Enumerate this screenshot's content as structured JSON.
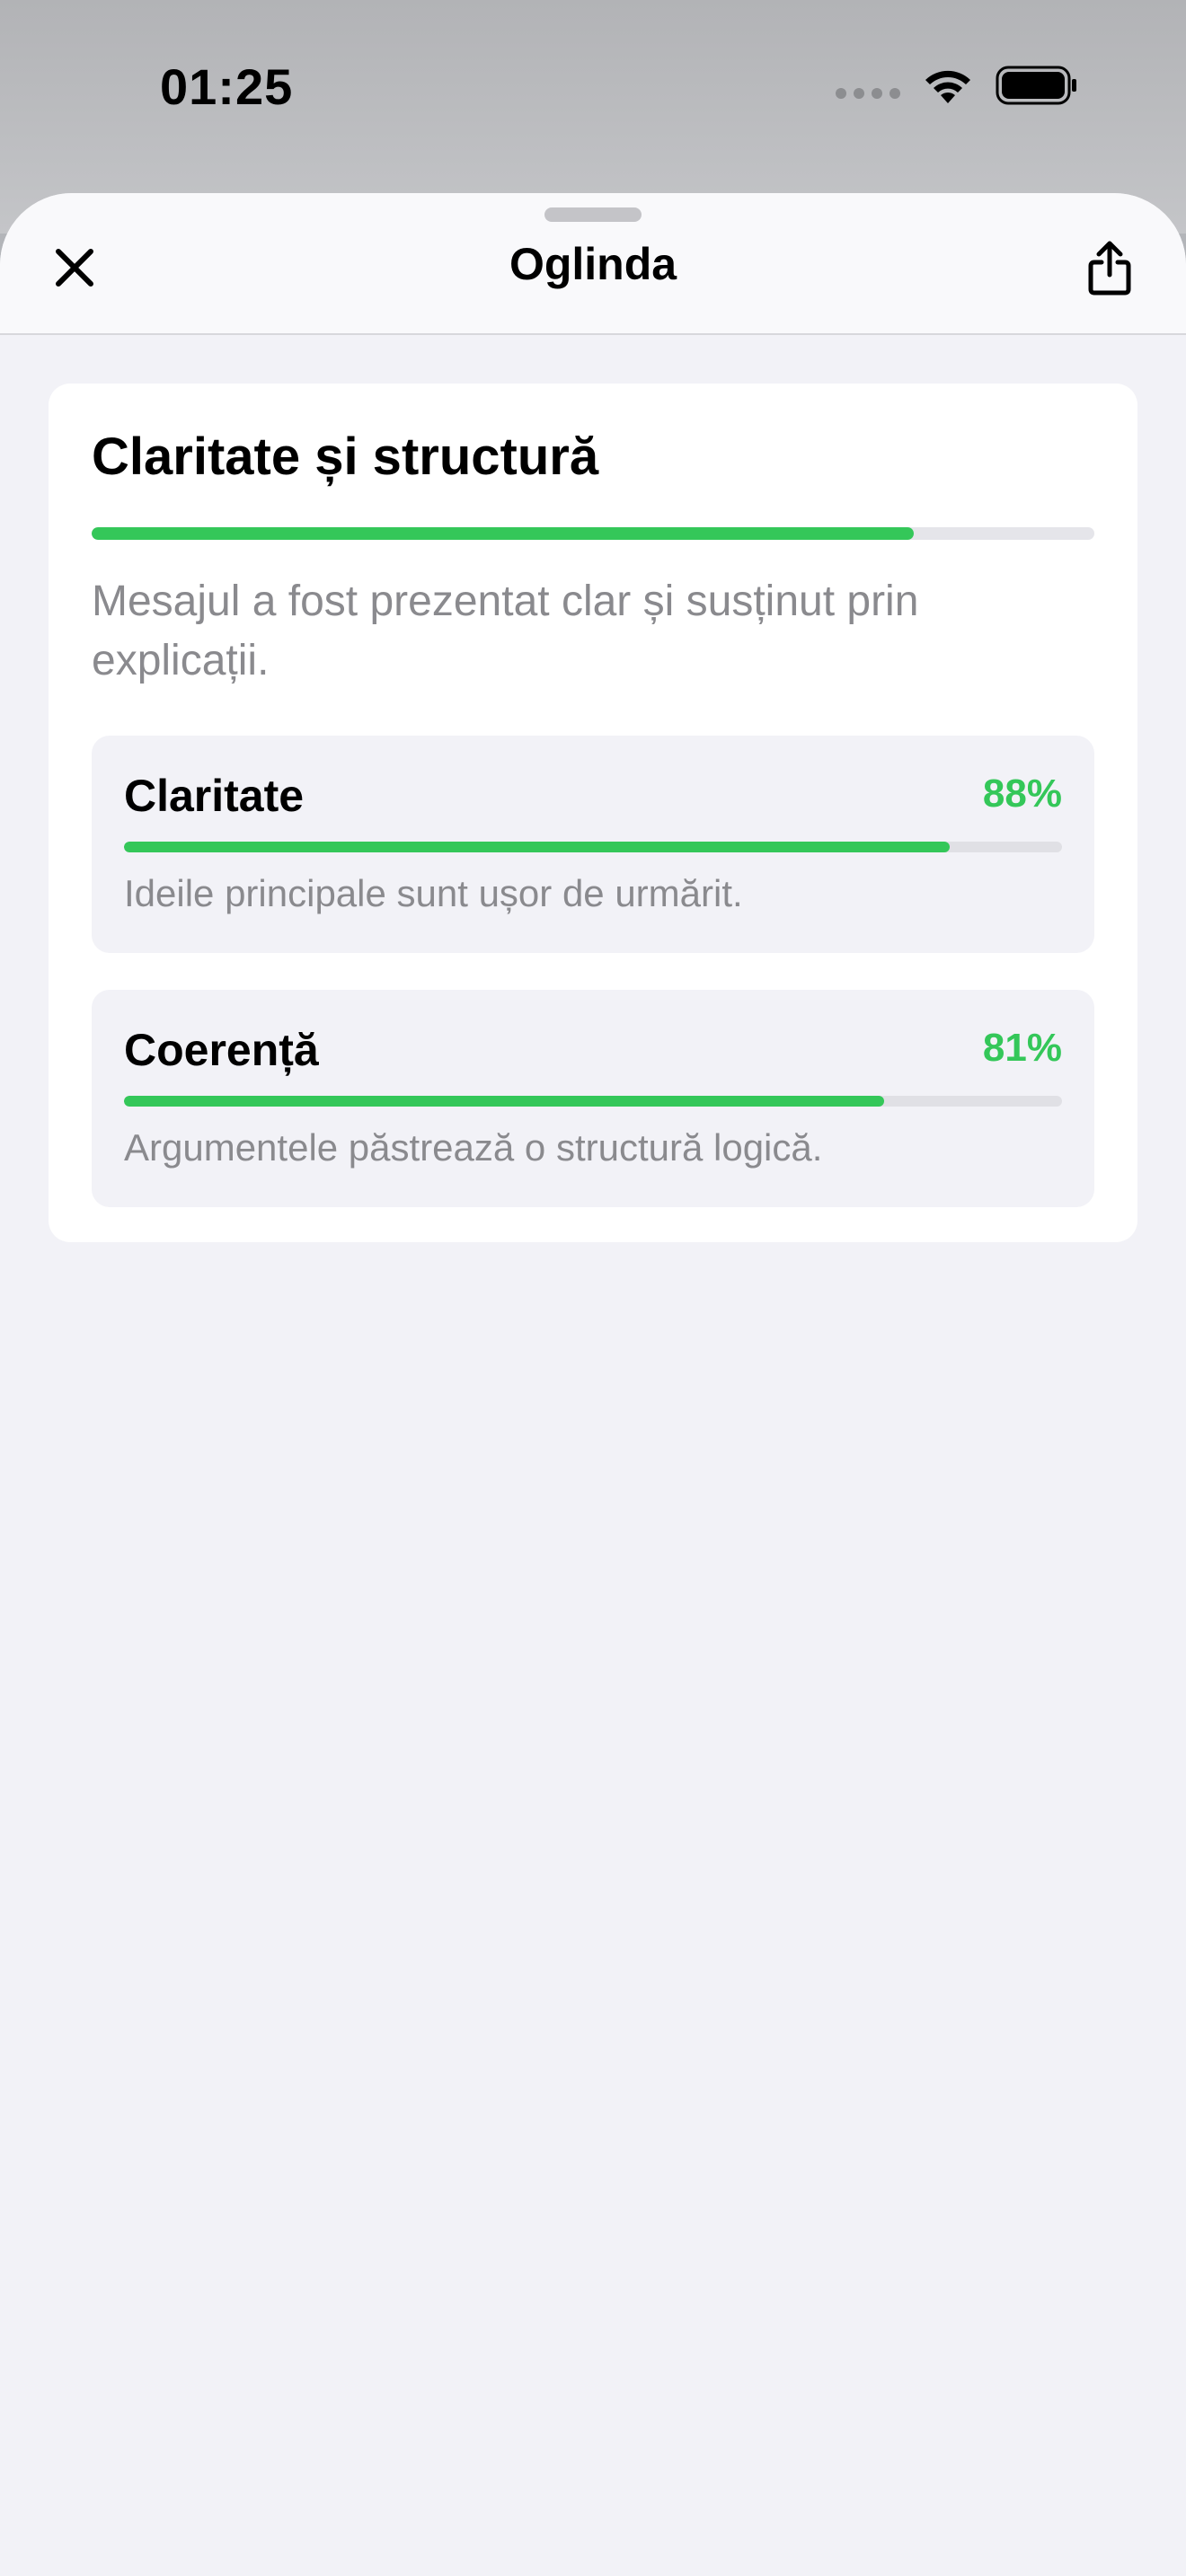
{
  "status_bar": {
    "time": "01:25"
  },
  "sheet": {
    "title": "Oglinda",
    "close_icon": "close-icon",
    "share_icon": "share-icon"
  },
  "section": {
    "title": "Claritate și structură",
    "progress": 0.82,
    "description": "Mesajul a fost prezentat clar și susținut prin explicații."
  },
  "metrics": [
    {
      "name": "Claritate",
      "value": "88%",
      "progress": 0.88,
      "description": "Ideile principale sunt ușor de urmărit."
    },
    {
      "name": "Coerență",
      "value": "81%",
      "progress": 0.81,
      "description": "Argumentele păstrează o structură logică."
    }
  ],
  "colors": {
    "accent": "#34c759",
    "background": "#f2f2f7",
    "card": "#ffffff",
    "secondary_text": "#8a8a8e"
  }
}
